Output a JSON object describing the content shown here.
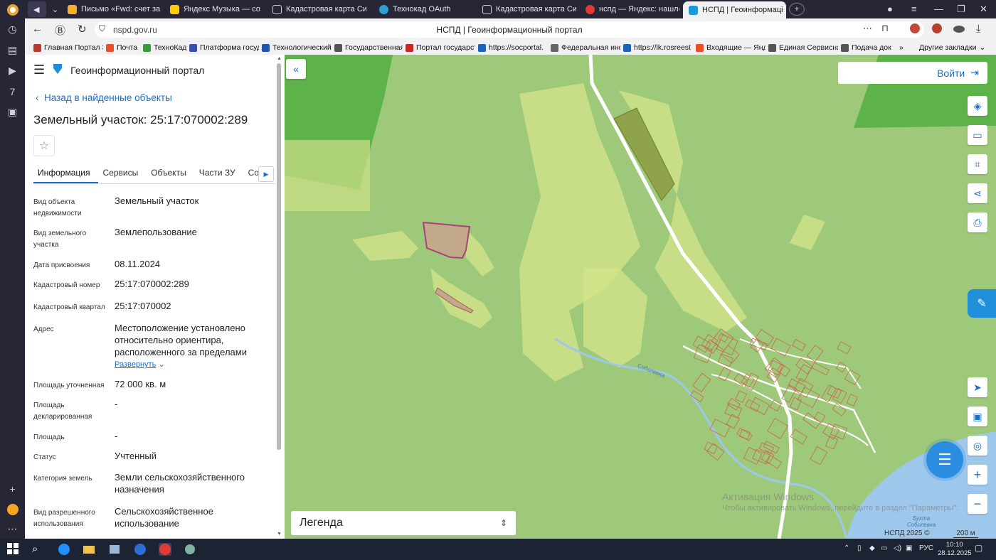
{
  "browser": {
    "tabs": [
      {
        "label": "Письмо «Fwd: счет за де",
        "color": "#f5b027"
      },
      {
        "label": "Яндекс Музыка — со",
        "color": "#ffcc00"
      },
      {
        "label": "Кадастровая карта Сибир",
        "color": "#ffffff"
      },
      {
        "label": "Технокад OAuth",
        "color": "#2a9fd6"
      },
      {
        "label": "Кадастровая карта Сибир",
        "color": "#ffffff"
      },
      {
        "label": "нспд — Яндекс: нашлось",
        "color": "#e53935"
      },
      {
        "label": "НСПД | Геоинформаці",
        "color": "#1a9ad6"
      }
    ],
    "url_host": "nspd.gov.ru",
    "page_title": "НСПД | Геоинформационный портал",
    "bookmarks": [
      {
        "label": "Главная Портал З",
        "color": "#b73c2e"
      },
      {
        "label": "Почта",
        "color": "#e8502a"
      },
      {
        "label": "ТехноКад",
        "color": "#3b9b3b"
      },
      {
        "label": "Платформа госуд",
        "color": "#3b4fa8"
      },
      {
        "label": "Технологический",
        "color": "#2255aa"
      },
      {
        "label": "Государственная",
        "color": "#555555"
      },
      {
        "label": "Портал государст",
        "color": "#c62828"
      },
      {
        "label": "https://socportal.",
        "color": "#1e63b5"
      },
      {
        "label": "Федеральная инф",
        "color": "#666666"
      },
      {
        "label": "https://lk.rosreest",
        "color": "#1e63b5"
      },
      {
        "label": "Входящие — Янде",
        "color": "#e8502a"
      },
      {
        "label": "Единая Сервисна",
        "color": "#555555"
      },
      {
        "label": "Подача док",
        "color": "#555555"
      }
    ],
    "bookmarks_more": "Другие закладки"
  },
  "sidebar": {
    "portal_title": "Геоинформационный портал",
    "back_label": "Назад в найденные объекты",
    "object_title": "Земельный участок: 25:17:070002:289",
    "tabs": [
      "Информация",
      "Сервисы",
      "Объекты",
      "Части ЗУ",
      "Соста",
      "П"
    ],
    "fields": [
      {
        "label": "Вид объекта недвижимости",
        "value": "Земельный участок"
      },
      {
        "label": "Вид земельного участка",
        "value": "Землепользование"
      },
      {
        "label": "Дата присвоения",
        "value": "08.11.2024"
      },
      {
        "label": "Кадастровый номер",
        "value": "25:17:070002:289"
      },
      {
        "label": "Кадастровый квартал",
        "value": "25:17:070002"
      },
      {
        "label": "Адрес",
        "value": "Местоположение установлено относительно ориентира, расположенного за пределами"
      },
      {
        "label": "Площадь уточненная",
        "value": "72 000 кв. м"
      },
      {
        "label": "Площадь декларированная",
        "value": "-"
      },
      {
        "label": "Площадь",
        "value": "-"
      },
      {
        "label": "Статус",
        "value": "Учтенный"
      },
      {
        "label": "Категория земель",
        "value": "Земли сельскохозяйственного назначения"
      },
      {
        "label": "Вид разрешенного использования",
        "value": "Сельскохозяйственное использование"
      }
    ],
    "expand_label": "Развернуть"
  },
  "map": {
    "login_label": "Войти",
    "legend_label": "Легенда",
    "copyright": "НСПД 2025 ©",
    "scale": "200 м",
    "watermark_title": "Активация Windows",
    "watermark_sub": "Чтобы активировать Windows, перейдите в раздел \"Параметры\".",
    "label_river": "Соболевка",
    "label_bay": "Бухта Соболевка",
    "colors": {
      "forest": "#5eb24a",
      "field": "#9ec97a",
      "zone": "#d2e38a",
      "water": "#9ec7ec",
      "road": "#ffffff",
      "parcel": "#a7427c"
    }
  },
  "taskbar": {
    "lang": "РУС",
    "time": "10:10",
    "date": "28.12.2025"
  }
}
